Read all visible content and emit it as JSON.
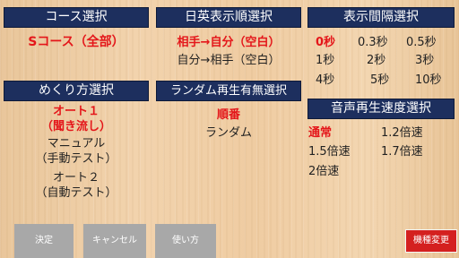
{
  "course": {
    "header": "コース選択",
    "options": [
      "Sコース（全部）"
    ]
  },
  "display_order": {
    "header": "日英表示順選択",
    "options": [
      "相手→自分（空白）",
      "自分→相手（空白）"
    ]
  },
  "interval": {
    "header": "表示間隔選択",
    "options": [
      "0秒",
      "0.3秒",
      "0.5秒",
      "1秒",
      "2秒",
      "3秒",
      "4秒",
      "5秒",
      "10秒"
    ]
  },
  "flip_method": {
    "header": "めくり方選択",
    "options": [
      {
        "line1": "オート１",
        "line2": "（聞き流し）"
      },
      {
        "line1": "マニュアル",
        "line2": "（手動テスト）"
      },
      {
        "line1": "オート２",
        "line2": "（自動テスト）"
      }
    ]
  },
  "random": {
    "header": "ランダム再生有無選択",
    "options": [
      "順番",
      "ランダム"
    ]
  },
  "speed": {
    "header": "音声再生速度選択",
    "options": [
      "通常",
      "1.2倍速",
      "1.5倍速",
      "1.7倍速",
      "2倍速"
    ]
  },
  "buttons": {
    "decide": "決定",
    "cancel": "キャンセル",
    "howto": "使い方",
    "change_model": "機種変更"
  },
  "colors": {
    "header_bg": "#1d2f5e",
    "selected_text": "#e4161a",
    "button_gray": "#a8a8a8",
    "button_red": "#d4201f"
  }
}
